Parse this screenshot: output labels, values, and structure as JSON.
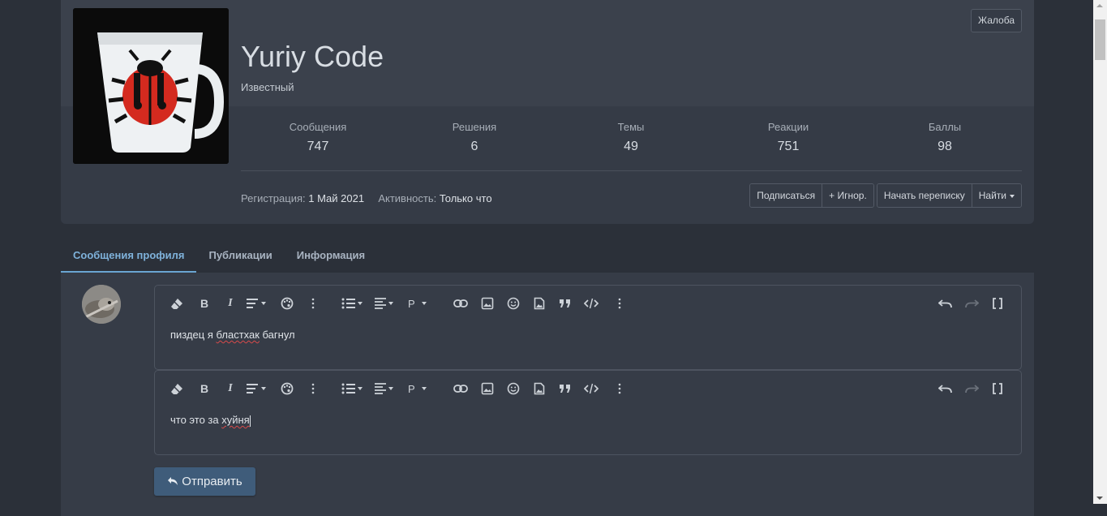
{
  "profile": {
    "username": "Yuriy Code",
    "user_title": "Известный",
    "report_label": "Жалоба",
    "stats": [
      {
        "label": "Сообщения",
        "value": "747"
      },
      {
        "label": "Решения",
        "value": "6"
      },
      {
        "label": "Темы",
        "value": "49"
      },
      {
        "label": "Реакции",
        "value": "751"
      },
      {
        "label": "Баллы",
        "value": "98"
      }
    ],
    "registration_label": "Регистрация:",
    "registration_value": "1 Май 2021",
    "activity_label": "Активность:",
    "activity_value": "Только что",
    "actions": {
      "follow": "Подписаться",
      "ignore": "+ Игнор.",
      "start_conversation": "Начать переписку",
      "find": "Найти"
    }
  },
  "tabs": [
    {
      "label": "Сообщения профиля",
      "active": true
    },
    {
      "label": "Публикации",
      "active": false
    },
    {
      "label": "Информация",
      "active": false
    }
  ],
  "toolbar": {
    "paragraph_label": "P"
  },
  "editors": [
    {
      "text_pre": "пиздец я ",
      "text_sq": "бластхак",
      "text_post": " багнул"
    },
    {
      "text_pre": "что это за ",
      "text_sq": "хуйня",
      "text_post": ""
    }
  ],
  "submit_label": "Отправить",
  "colors": {
    "background": "#2b3039",
    "card": "#353b46",
    "accent": "#6aa5d2",
    "submit": "#3f5c7a"
  }
}
